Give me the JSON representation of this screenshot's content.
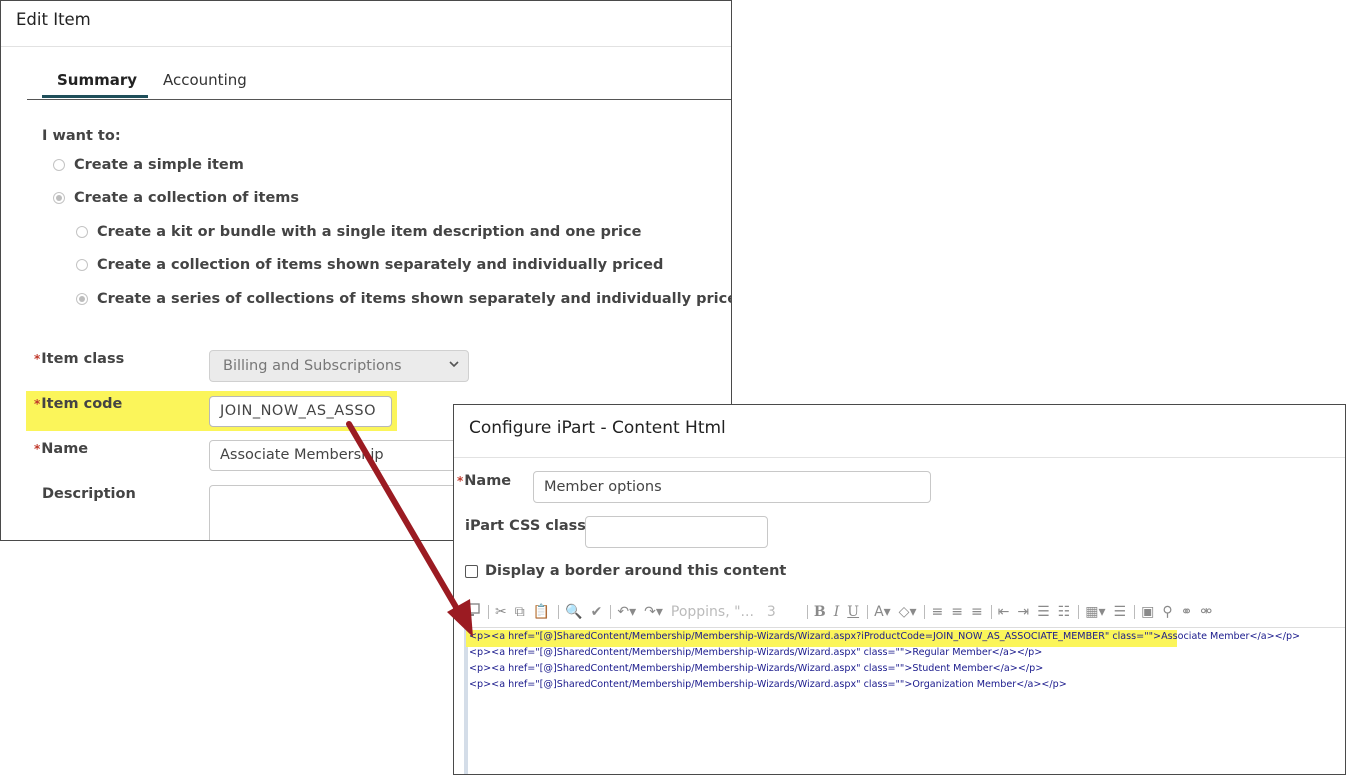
{
  "edit_item": {
    "title": "Edit Item",
    "tabs": [
      {
        "label": "Summary",
        "active": true
      },
      {
        "label": "Accounting",
        "active": false
      }
    ],
    "i_want_to": "I want to:",
    "options": [
      {
        "label": "Create a simple item",
        "checked": false
      },
      {
        "label": "Create a collection of items",
        "checked": true
      }
    ],
    "sub_options": [
      {
        "label": "Create a kit or bundle with a single item description and one price",
        "checked": false
      },
      {
        "label": "Create a collection of items shown separately and individually priced",
        "checked": false
      },
      {
        "label": "Create a series of collections of items shown separately and individually priced",
        "checked": true
      }
    ],
    "required_mark": "*",
    "item_class": {
      "label": "Item class",
      "value": "Billing and Subscriptions"
    },
    "item_code": {
      "label": "Item code",
      "value": "JOIN_NOW_AS_ASSO"
    },
    "name": {
      "label": "Name",
      "value": "Associate Membership"
    },
    "description": {
      "label": "Description",
      "value": ""
    }
  },
  "ipart": {
    "title": "Configure iPart - Content Html",
    "required_mark": "*",
    "name": {
      "label": "Name",
      "value": "Member options"
    },
    "css_class": {
      "label": "iPart CSS class",
      "value": ""
    },
    "border_checkbox": {
      "label": "Display a border around this content",
      "checked": false
    },
    "toolbar": {
      "font": "Poppins, \"...",
      "size": "3"
    },
    "code_lines": [
      "<p><a href=\"[@]SharedContent/Membership/Membership-Wizards/Wizard.aspx?iProductCode=JOIN_NOW_AS_ASSOCIATE_MEMBER\" class=\"\">Associate Member</a></p>",
      "<p><a href=\"[@]SharedContent/Membership/Membership-Wizards/Wizard.aspx\" class=\"\">Regular Member</a></p>",
      "<p><a href=\"[@]SharedContent/Membership/Membership-Wizards/Wizard.aspx\" class=\"\">Student Member</a></p>",
      "<p><a href=\"[@]SharedContent/Membership/Membership-Wizards/Wizard.aspx\" class=\"\">Organization Member</a></p>"
    ]
  },
  "colors": {
    "highlight": "#fbf55a",
    "arrow": "#9b1b22",
    "tab_underline": "#1f4f5a",
    "required": "#c0392b"
  }
}
